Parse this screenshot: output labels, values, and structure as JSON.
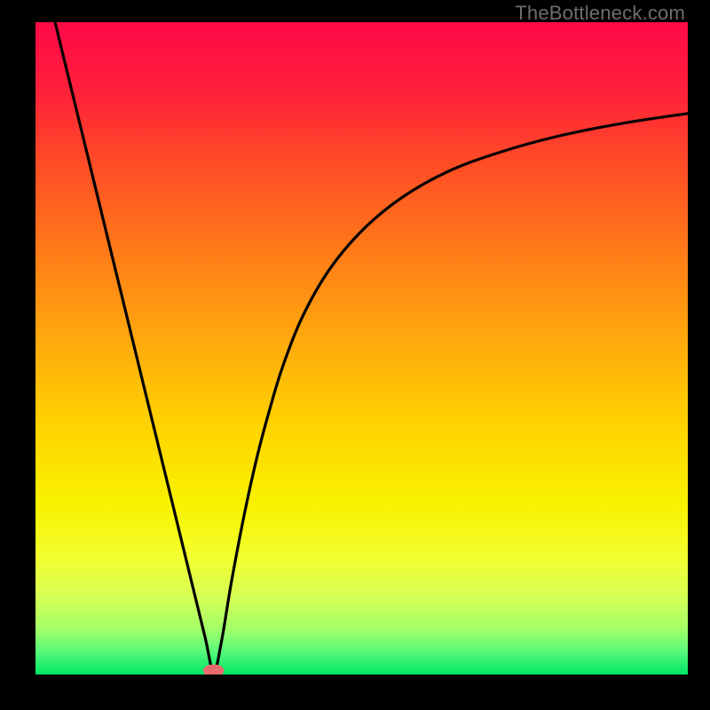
{
  "watermark": "TheBottleneck.com",
  "chart_data": {
    "type": "line",
    "title": "",
    "xlabel": "",
    "ylabel": "",
    "xlim": [
      0,
      100
    ],
    "ylim": [
      0,
      100
    ],
    "gradient_stops": [
      {
        "offset": 0.0,
        "color": "#ff0a47"
      },
      {
        "offset": 0.1,
        "color": "#ff1f3a"
      },
      {
        "offset": 0.22,
        "color": "#ff4d26"
      },
      {
        "offset": 0.35,
        "color": "#ff7a18"
      },
      {
        "offset": 0.5,
        "color": "#ffad0c"
      },
      {
        "offset": 0.62,
        "color": "#ffd400"
      },
      {
        "offset": 0.74,
        "color": "#f8f200"
      },
      {
        "offset": 0.82,
        "color": "#f3ff2f"
      },
      {
        "offset": 0.88,
        "color": "#d7ff55"
      },
      {
        "offset": 0.93,
        "color": "#a3ff68"
      },
      {
        "offset": 0.965,
        "color": "#58f97a"
      },
      {
        "offset": 1.0,
        "color": "#00e664"
      }
    ],
    "series": [
      {
        "name": "curve",
        "x": [
          3.0,
          6.0,
          9.0,
          12.0,
          15.0,
          18.0,
          21.0,
          24.0,
          26.0,
          27.3,
          28.5,
          30.0,
          32.0,
          34.0,
          36.0,
          38.0,
          41.0,
          45.0,
          50.0,
          56.0,
          63.0,
          71.0,
          80.0,
          90.0,
          100.0
        ],
        "y": [
          100.0,
          87.7,
          75.4,
          63.1,
          50.8,
          38.5,
          26.2,
          13.9,
          5.7,
          0.4,
          5.0,
          14.0,
          24.5,
          33.5,
          41.0,
          47.5,
          55.0,
          62.0,
          68.0,
          73.0,
          77.0,
          80.0,
          82.5,
          84.5,
          86.0
        ]
      }
    ],
    "marker": {
      "x": 27.3,
      "y": 0.6,
      "rx": 1.6,
      "ry": 0.95,
      "color": "#e86a6d"
    }
  }
}
